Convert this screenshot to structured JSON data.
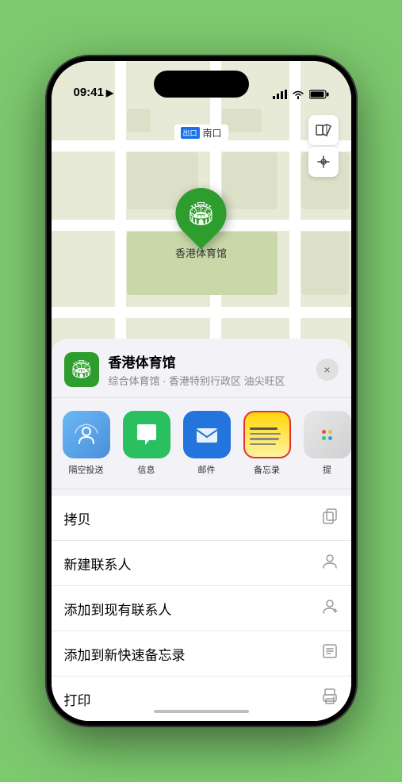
{
  "status_bar": {
    "time": "09:41",
    "location_icon": "▶"
  },
  "map": {
    "location_label_tag": "出口",
    "location_label_text": "南口",
    "pin_label": "香港体育馆",
    "pin_emoji": "🏟"
  },
  "place_card": {
    "name": "香港体育馆",
    "subtitle": "综合体育馆 · 香港特别行政区 油尖旺区",
    "close_label": "×"
  },
  "share_items": [
    {
      "id": "airdrop",
      "label": "隔空投送"
    },
    {
      "id": "message",
      "label": "信息",
      "emoji": "💬"
    },
    {
      "id": "mail",
      "label": "邮件",
      "emoji": "✉️"
    },
    {
      "id": "notes",
      "label": "备忘录"
    },
    {
      "id": "more",
      "label": "提"
    }
  ],
  "actions": [
    {
      "label": "拷贝",
      "icon": "⎘"
    },
    {
      "label": "新建联系人",
      "icon": "👤"
    },
    {
      "label": "添加到现有联系人",
      "icon": "👤"
    },
    {
      "label": "添加到新快速备忘录",
      "icon": "🖼"
    },
    {
      "label": "打印",
      "icon": "🖨"
    }
  ]
}
